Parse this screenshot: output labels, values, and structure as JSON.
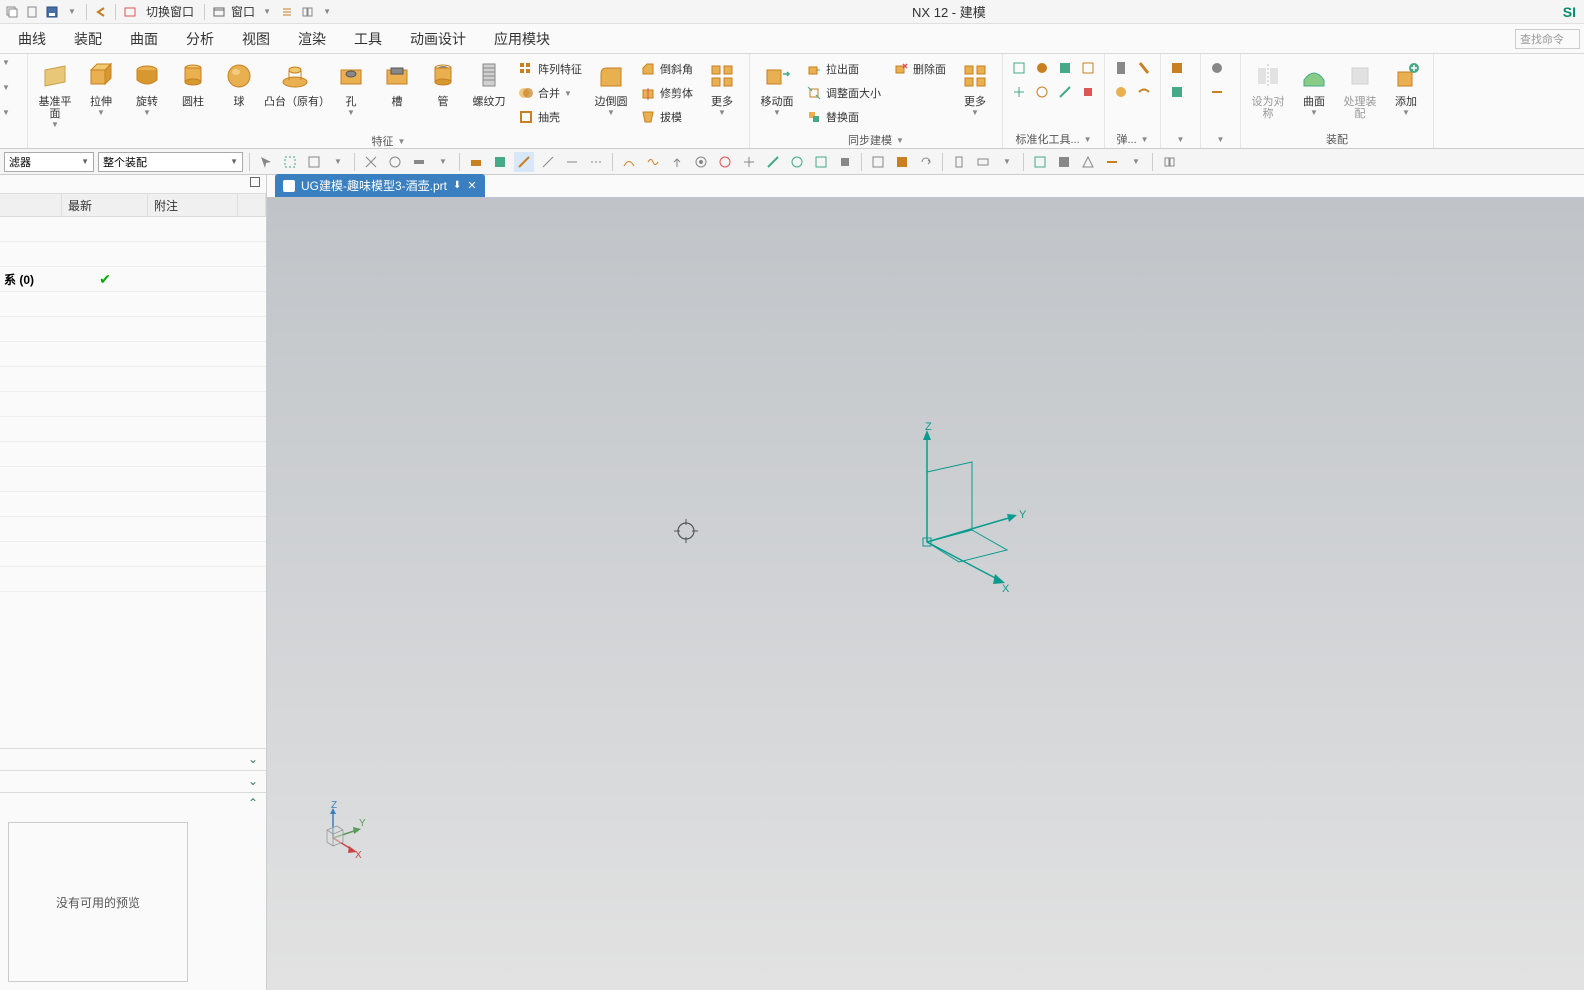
{
  "title": "NX 12 - 建模",
  "brand": "SI",
  "qat": {
    "switch_window": "切换窗口",
    "window": "窗口"
  },
  "menu": [
    "曲线",
    "装配",
    "曲面",
    "分析",
    "视图",
    "渲染",
    "工具",
    "动画设计",
    "应用模块"
  ],
  "search_placeholder": "查找命令",
  "ribbon": {
    "group1": {
      "datum": "基准平面",
      "extrude": "拉伸",
      "revolve": "旋转",
      "cylinder": "圆柱",
      "sphere": "球",
      "boss": "凸台（原有）",
      "hole": "孔",
      "slot": "槽",
      "tube": "管",
      "thread": "螺纹刀",
      "pattern": "阵列特征",
      "combine": "合并",
      "shell": "抽壳",
      "chamfer": "边倒圆",
      "more1": "更多",
      "draft1": "倒斜角",
      "trim": "修剪体",
      "draft2": "拔模",
      "label": "特征"
    },
    "group2": {
      "moveface": "移动面",
      "pull": "拉出面",
      "resize": "调整面大小",
      "replace": "替换面",
      "delface": "删除面",
      "more2": "更多",
      "label": "同步建模"
    },
    "group3": {
      "label": "标准化工具..."
    },
    "group4": {
      "label": "弹..."
    },
    "group5": {
      "setobj": "设为对称",
      "curved": "曲面",
      "procasm": "处理装配",
      "add": "添加",
      "label": "装配"
    }
  },
  "toolbar2": {
    "filter": "滤器",
    "assembly": "整个装配"
  },
  "tab": {
    "filename": "UG建模-趣味模型3-酒壶.prt"
  },
  "side": {
    "col1": "",
    "col2": "最新",
    "col3": "附注",
    "row_label": "系 (0)",
    "preview": "没有可用的预览"
  },
  "axes": {
    "x": "X",
    "y": "Y",
    "z": "Z"
  }
}
